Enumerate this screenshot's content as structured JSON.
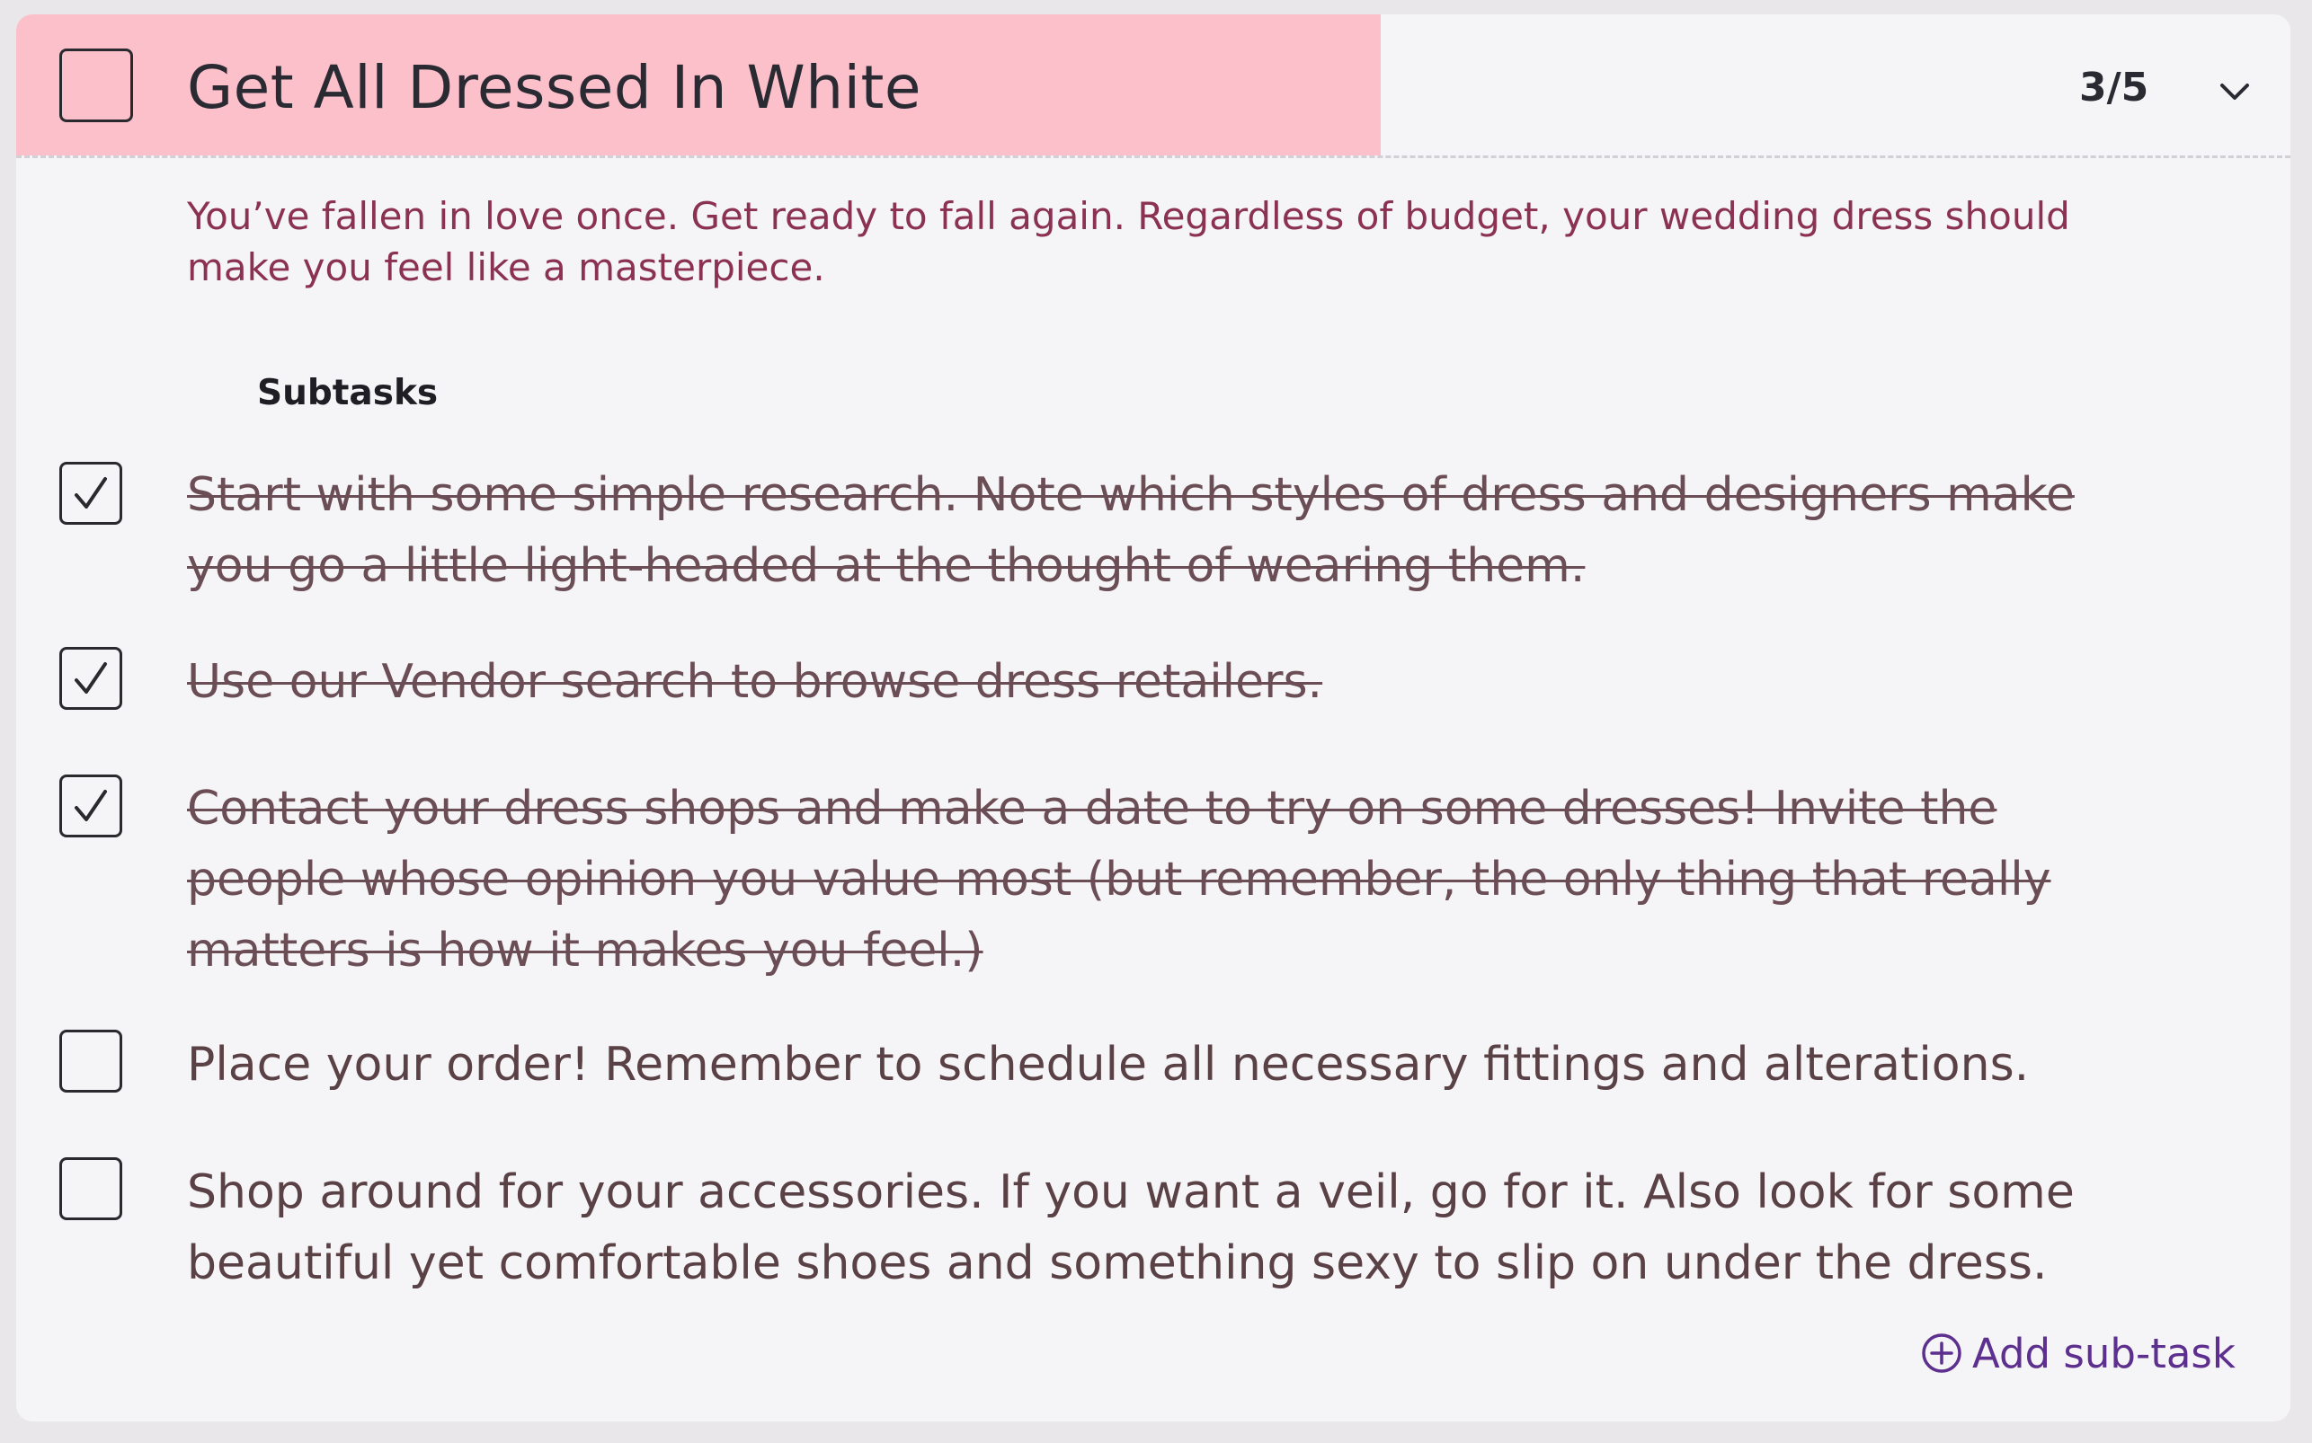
{
  "task": {
    "title": "Get All Dressed In White",
    "count_label": "3/5",
    "progress": 0.6,
    "completed": false,
    "description": "You’ve fallen in love once. Get ready to fall again. Regardless of budget, your wedding dress should make you feel like a masterpiece."
  },
  "subtasks": {
    "heading": "Subtasks",
    "items": [
      {
        "text": "Start with some simple research. Note which styles of dress and designers make you go a little light-headed at the thought of wearing them.",
        "done": true
      },
      {
        "text": "Use our Vendor search to browse dress retailers.",
        "done": true
      },
      {
        "text": "Contact your dress shops and make a date to try on some dresses! Invite the people whose opinion you value most (but remember, the only thing that really matters is how it makes you feel.)",
        "done": true
      },
      {
        "text": "Place your order! Remember to schedule all necessary fittings and alterations.",
        "done": false
      },
      {
        "text": "Shop around for your accessories. If you want a veil, go for it. Also look for some beautiful yet comfortable shoes and something sexy to slip on under the dress.",
        "done": false
      }
    ],
    "add_label": "Add sub-task"
  },
  "colors": {
    "progress_fill": "#fcc0cb",
    "description_text": "#8b3152",
    "accent": "#5d2f8e"
  },
  "icons": {
    "expand": "chevron-down-icon",
    "check": "checkmark-icon",
    "add": "plus-circle-icon"
  }
}
